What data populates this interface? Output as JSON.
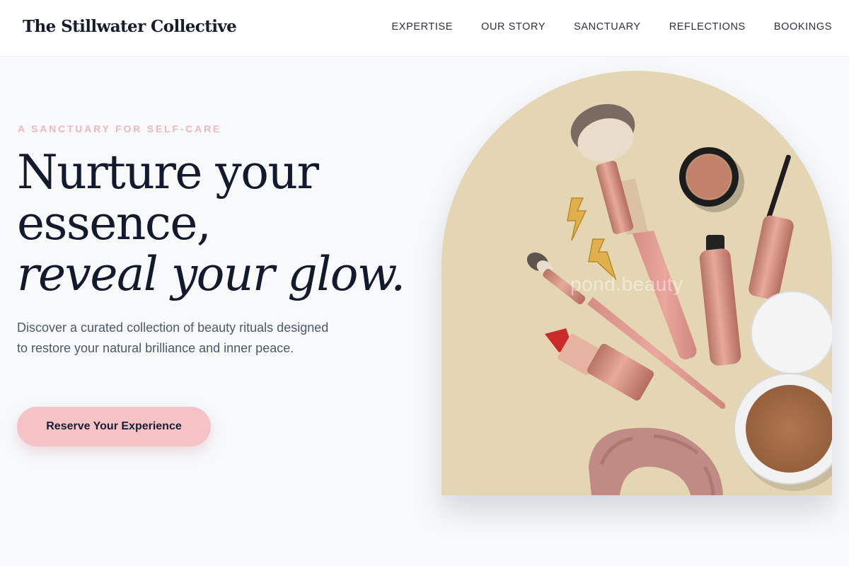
{
  "brand": {
    "name": "The Stillwater Collective"
  },
  "nav": {
    "items": [
      {
        "label": "EXPERTISE"
      },
      {
        "label": "OUR STORY"
      },
      {
        "label": "SANCTUARY"
      },
      {
        "label": "REFLECTIONS"
      },
      {
        "label": "BOOKINGS"
      }
    ]
  },
  "hero": {
    "eyebrow": "A SANCTUARY FOR SELF-CARE",
    "headline_line1": "Nurture your",
    "headline_line2": "essence,",
    "headline_line3": "reveal your glow.",
    "lede": "Discover a curated collection of beauty rituals designed to restore your natural brilliance and inner peace.",
    "cta_label": "Reserve Your Experience"
  },
  "image": {
    "watermark": "pond.beauty",
    "subject": "flat-lay of makeup brushes, lipstick, mascara, compact powder, scrunchie and earrings"
  },
  "colors": {
    "accent_pink": "#f5c3c5",
    "eyebrow_pink": "#f0b7b9",
    "heading_navy": "#131a2d",
    "page_bg": "#f7f9fb",
    "arch_bg": "#e5d6b3"
  }
}
